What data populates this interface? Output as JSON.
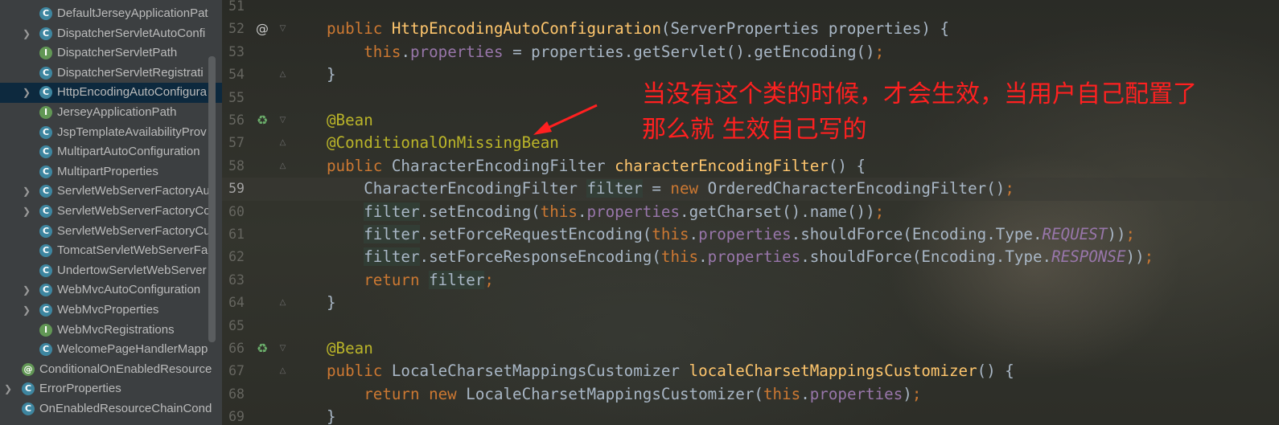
{
  "project_tree": {
    "items": [
      {
        "label": "DefaultJerseyApplicationPat",
        "icon": "class-icon",
        "expandable": false,
        "indent": 1
      },
      {
        "label": "DispatcherServletAutoConfi",
        "icon": "class-icon",
        "expandable": true,
        "indent": 1
      },
      {
        "label": "DispatcherServletPath",
        "icon": "interface-icon",
        "expandable": false,
        "indent": 1
      },
      {
        "label": "DispatcherServletRegistrati",
        "icon": "class-icon",
        "expandable": false,
        "indent": 1
      },
      {
        "label": "HttpEncodingAutoConfigura",
        "icon": "class-icon",
        "expandable": true,
        "indent": 1,
        "selected": true
      },
      {
        "label": "JerseyApplicationPath",
        "icon": "interface-icon",
        "expandable": false,
        "indent": 1
      },
      {
        "label": "JspTemplateAvailabilityProv",
        "icon": "class-icon",
        "expandable": false,
        "indent": 1
      },
      {
        "label": "MultipartAutoConfiguration",
        "icon": "class-icon",
        "expandable": false,
        "indent": 1
      },
      {
        "label": "MultipartProperties",
        "icon": "class-icon",
        "expandable": false,
        "indent": 1
      },
      {
        "label": "ServletWebServerFactoryAu",
        "icon": "class-icon",
        "expandable": true,
        "indent": 1
      },
      {
        "label": "ServletWebServerFactoryCo",
        "icon": "class-icon",
        "expandable": true,
        "indent": 1
      },
      {
        "label": "ServletWebServerFactoryCu",
        "icon": "class-icon",
        "expandable": false,
        "indent": 1
      },
      {
        "label": "TomcatServletWebServerFa",
        "icon": "class-icon",
        "expandable": false,
        "indent": 1
      },
      {
        "label": "UndertowServletWebServer",
        "icon": "class-icon",
        "expandable": false,
        "indent": 1
      },
      {
        "label": "WebMvcAutoConfiguration",
        "icon": "class-icon",
        "expandable": true,
        "indent": 1
      },
      {
        "label": "WebMvcProperties",
        "icon": "class-icon",
        "expandable": true,
        "indent": 1
      },
      {
        "label": "WebMvcRegistrations",
        "icon": "interface-icon",
        "expandable": false,
        "indent": 1
      },
      {
        "label": "WelcomePageHandlerMapp",
        "icon": "class-icon",
        "expandable": false,
        "indent": 1
      },
      {
        "label": "ConditionalOnEnabledResource",
        "icon": "annotation-icon",
        "expandable": false,
        "indent": 0
      },
      {
        "label": "ErrorProperties",
        "icon": "class-icon",
        "expandable": true,
        "indent": 0
      },
      {
        "label": "OnEnabledResourceChainCond",
        "icon": "class-icon",
        "expandable": false,
        "indent": 0
      }
    ]
  },
  "editor": {
    "current_line": "59",
    "lines": [
      {
        "num": "51",
        "gutter_icon": "",
        "fold": "",
        "tokens": []
      },
      {
        "num": "52",
        "gutter_icon": "at-icon",
        "fold": "fold-open",
        "tokens": [
          {
            "t": "public ",
            "c": "kw"
          },
          {
            "t": "HttpEncodingAutoConfiguration",
            "c": "fn"
          },
          {
            "t": "(ServerProperties properties) {",
            "c": "plain"
          }
        ]
      },
      {
        "num": "53",
        "gutter_icon": "",
        "fold": "",
        "tokens": [
          {
            "t": "    ",
            "c": "plain"
          },
          {
            "t": "this",
            "c": "kw"
          },
          {
            "t": ".",
            "c": "plain"
          },
          {
            "t": "properties",
            "c": "fld"
          },
          {
            "t": " = properties.getServlet().getEncoding()",
            "c": "plain"
          },
          {
            "t": ";",
            "c": "kw"
          }
        ]
      },
      {
        "num": "54",
        "gutter_icon": "",
        "fold": "fold-close",
        "tokens": [
          {
            "t": "}",
            "c": "plain"
          }
        ]
      },
      {
        "num": "55",
        "gutter_icon": "",
        "fold": "",
        "tokens": []
      },
      {
        "num": "56",
        "gutter_icon": "bean-icon",
        "fold": "fold-open",
        "tokens": [
          {
            "t": "@Bean",
            "c": "ann"
          }
        ]
      },
      {
        "num": "57",
        "gutter_icon": "",
        "fold": "fold-mid",
        "tokens": [
          {
            "t": "@ConditionalOnMissingBean",
            "c": "ann"
          }
        ]
      },
      {
        "num": "58",
        "gutter_icon": "",
        "fold": "fold-close",
        "tokens": [
          {
            "t": "public ",
            "c": "kw"
          },
          {
            "t": "CharacterEncodingFilter ",
            "c": "plain"
          },
          {
            "t": "characterEncodingFilter",
            "c": "fn"
          },
          {
            "t": "() {",
            "c": "plain"
          }
        ]
      },
      {
        "num": "59",
        "gutter_icon": "",
        "fold": "",
        "tokens": [
          {
            "t": "    CharacterEncodingFilter ",
            "c": "plain"
          },
          {
            "t": "filter",
            "c": "var"
          },
          {
            "t": " = ",
            "c": "plain"
          },
          {
            "t": "new ",
            "c": "kw"
          },
          {
            "t": "OrderedCharacterEncodingFilter()",
            "c": "plain"
          },
          {
            "t": ";",
            "c": "kw"
          }
        ]
      },
      {
        "num": "60",
        "gutter_icon": "",
        "fold": "",
        "tokens": [
          {
            "t": "    ",
            "c": "plain"
          },
          {
            "t": "filter",
            "c": "var"
          },
          {
            "t": ".setEncoding(",
            "c": "plain"
          },
          {
            "t": "this",
            "c": "kw"
          },
          {
            "t": ".",
            "c": "plain"
          },
          {
            "t": "properties",
            "c": "fld"
          },
          {
            "t": ".getCharset().name())",
            "c": "plain"
          },
          {
            "t": ";",
            "c": "kw"
          }
        ]
      },
      {
        "num": "61",
        "gutter_icon": "",
        "fold": "",
        "tokens": [
          {
            "t": "    ",
            "c": "plain"
          },
          {
            "t": "filter",
            "c": "var"
          },
          {
            "t": ".setForceRequestEncoding(",
            "c": "plain"
          },
          {
            "t": "this",
            "c": "kw"
          },
          {
            "t": ".",
            "c": "plain"
          },
          {
            "t": "properties",
            "c": "fld"
          },
          {
            "t": ".shouldForce(Encoding.Type.",
            "c": "plain"
          },
          {
            "t": "REQUEST",
            "c": "ital"
          },
          {
            "t": "))",
            "c": "plain"
          },
          {
            "t": ";",
            "c": "kw"
          }
        ]
      },
      {
        "num": "62",
        "gutter_icon": "",
        "fold": "",
        "tokens": [
          {
            "t": "    ",
            "c": "plain"
          },
          {
            "t": "filter",
            "c": "var"
          },
          {
            "t": ".setForceResponseEncoding(",
            "c": "plain"
          },
          {
            "t": "this",
            "c": "kw"
          },
          {
            "t": ".",
            "c": "plain"
          },
          {
            "t": "properties",
            "c": "fld"
          },
          {
            "t": ".shouldForce(Encoding.Type.",
            "c": "plain"
          },
          {
            "t": "RESPONSE",
            "c": "ital"
          },
          {
            "t": "))",
            "c": "plain"
          },
          {
            "t": ";",
            "c": "kw"
          }
        ]
      },
      {
        "num": "63",
        "gutter_icon": "",
        "fold": "",
        "tokens": [
          {
            "t": "    ",
            "c": "plain"
          },
          {
            "t": "return ",
            "c": "kw"
          },
          {
            "t": "filter",
            "c": "var"
          },
          {
            "t": ";",
            "c": "kw"
          }
        ]
      },
      {
        "num": "64",
        "gutter_icon": "",
        "fold": "fold-close",
        "tokens": [
          {
            "t": "}",
            "c": "plain"
          }
        ]
      },
      {
        "num": "65",
        "gutter_icon": "",
        "fold": "",
        "tokens": []
      },
      {
        "num": "66",
        "gutter_icon": "bean-icon",
        "fold": "fold-open",
        "tokens": [
          {
            "t": "@Bean",
            "c": "ann"
          }
        ]
      },
      {
        "num": "67",
        "gutter_icon": "",
        "fold": "fold-mid",
        "tokens": [
          {
            "t": "public ",
            "c": "kw"
          },
          {
            "t": "LocaleCharsetMappingsCustomizer ",
            "c": "plain"
          },
          {
            "t": "localeCharsetMappingsCustomizer",
            "c": "fn"
          },
          {
            "t": "() {",
            "c": "plain"
          }
        ]
      },
      {
        "num": "68",
        "gutter_icon": "",
        "fold": "",
        "tokens": [
          {
            "t": "    ",
            "c": "plain"
          },
          {
            "t": "return new ",
            "c": "kw"
          },
          {
            "t": "LocaleCharsetMappingsCustomizer(",
            "c": "plain"
          },
          {
            "t": "this",
            "c": "kw"
          },
          {
            "t": ".",
            "c": "plain"
          },
          {
            "t": "properties",
            "c": "fld"
          },
          {
            "t": ")",
            "c": "plain"
          },
          {
            "t": ";",
            "c": "kw"
          }
        ]
      },
      {
        "num": "69",
        "gutter_icon": "",
        "fold": "",
        "tokens": [
          {
            "t": "}",
            "c": "plain"
          }
        ]
      }
    ]
  },
  "annotation_note": {
    "line1": "当没有这个类的时候，才会生效，当用户自己配置了",
    "line2": "那么就 生效自己写的",
    "color": "#ff2020"
  },
  "colors": {
    "keyword": "#cc7832",
    "method": "#ffc66d",
    "field": "#9876aa",
    "annotation": "#bbb529",
    "text": "#a9b7c6",
    "selection": "#0d293e"
  }
}
